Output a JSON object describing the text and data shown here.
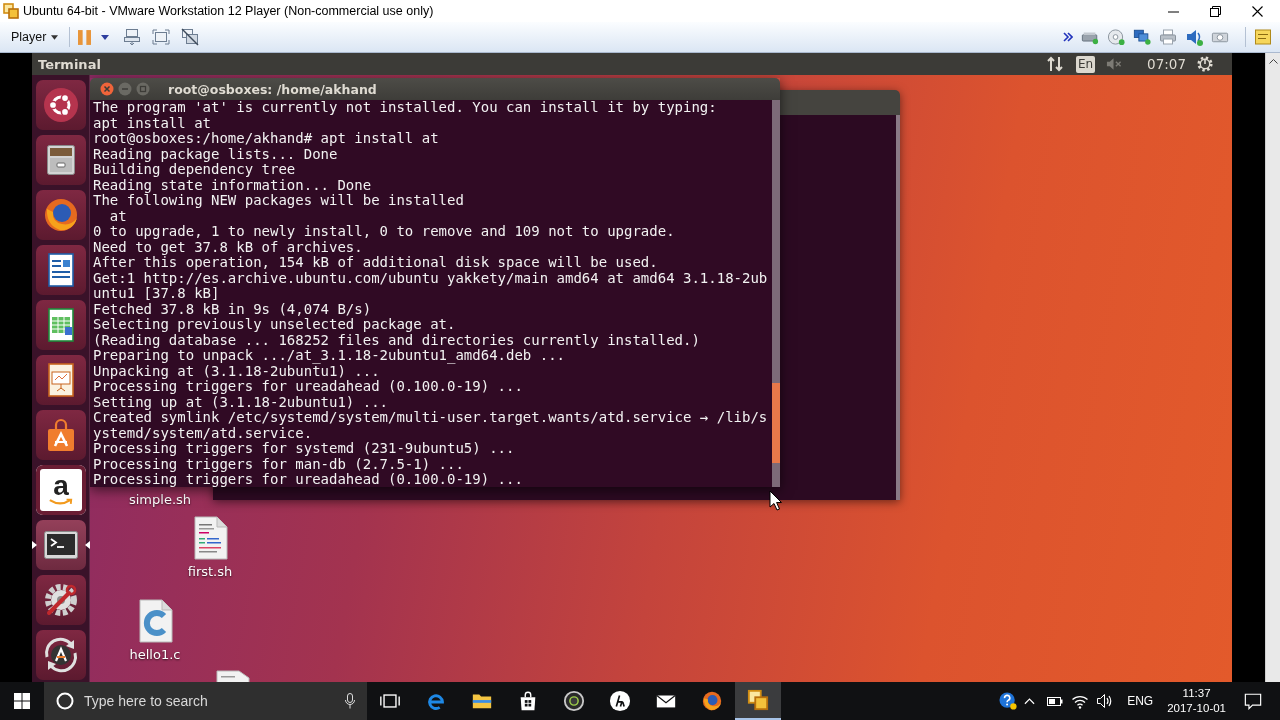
{
  "window": {
    "title": "Ubuntu 64-bit - VMware Workstation 12 Player (Non-commercial use only)"
  },
  "toolbar": {
    "menu": "Player"
  },
  "panel": {
    "app_title": "Terminal",
    "keyboard_layout": "En",
    "muted": true,
    "clock": "07:07"
  },
  "launcher": [
    {
      "kind": "ubuntu",
      "selected": false
    },
    {
      "kind": "files",
      "selected": false
    },
    {
      "kind": "firefox",
      "selected": false
    },
    {
      "kind": "writer",
      "selected": false
    },
    {
      "kind": "calc",
      "selected": false
    },
    {
      "kind": "impress",
      "selected": false
    },
    {
      "kind": "software",
      "selected": false
    },
    {
      "kind": "amazon",
      "glyph": "a",
      "selected": false
    },
    {
      "kind": "terminal",
      "selected": true
    },
    {
      "kind": "settings",
      "selected": false
    },
    {
      "kind": "updater",
      "selected": false
    }
  ],
  "terminal": {
    "title": "root@osboxes: /home/akhand",
    "lines": [
      "The program 'at' is currently not installed. You can install it by typing:",
      "apt install at",
      "root@osboxes:/home/akhand# apt install at",
      "Reading package lists... Done",
      "Building dependency tree",
      "Reading state information... Done",
      "The following NEW packages will be installed",
      "  at",
      "0 to upgrade, 1 to newly install, 0 to remove and 109 not to upgrade.",
      "Need to get 37.8 kB of archives.",
      "After this operation, 154 kB of additional disk space will be used.",
      "Get:1 http://es.archive.ubuntu.com/ubuntu yakkety/main amd64 at amd64 3.1.18-2ub",
      "untu1 [37.8 kB]",
      "Fetched 37.8 kB in 9s (4,074 B/s)",
      "Selecting previously unselected package at.",
      "(Reading database ... 168252 files and directories currently installed.)",
      "Preparing to unpack .../at_3.1.18-2ubuntu1_amd64.deb ...",
      "Unpacking at (3.1.18-2ubuntu1) ...",
      "Processing triggers for ureadahead (0.100.0-19) ...",
      "Setting up at (3.1.18-2ubuntu1) ...",
      "Created symlink /etc/systemd/system/multi-user.target.wants/atd.service → /lib/s",
      "ystemd/system/atd.service.",
      "Processing triggers for systemd (231-9ubuntu5) ...",
      "Processing triggers for man-db (2.7.5-1) ...",
      "Processing triggers for ureadahead (0.100.0-19) ..."
    ]
  },
  "desktop_icons": [
    {
      "kind": "label-only",
      "label": "simple.sh"
    },
    {
      "kind": "script",
      "label": "first.sh"
    },
    {
      "kind": "c-source",
      "label": "hello1.c"
    },
    {
      "kind": "partial-document"
    }
  ],
  "taskbar": {
    "search_placeholder": "Type here to search",
    "apps": [
      {
        "kind": "task-view",
        "selected": false
      },
      {
        "kind": "edge",
        "selected": false
      },
      {
        "kind": "explorer",
        "selected": false
      },
      {
        "kind": "store",
        "selected": false
      },
      {
        "kind": "camera",
        "selected": false
      },
      {
        "kind": "hp",
        "selected": false
      },
      {
        "kind": "mail",
        "selected": false
      },
      {
        "kind": "firefox",
        "selected": false
      },
      {
        "kind": "vmware",
        "selected": true
      }
    ],
    "language": "ENG",
    "time": "11:37",
    "date": "2017-10-01"
  }
}
